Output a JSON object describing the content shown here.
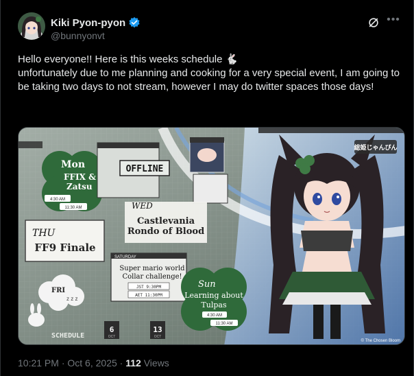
{
  "author": {
    "display_name": "Kiki Pyon-pyon",
    "handle": "@bunnyonvt"
  },
  "tweet": {
    "line1": "Hello everyone!! Here is this weeks schedule 🐇",
    "line2": "unfortunately due to me planning and cooking for a very special event, I am going to be taking two days to not stream, however I may do twitter spaces those days!"
  },
  "meta": {
    "time": "10:21 PM",
    "separator": "·",
    "date": "Oct 6, 2025",
    "views_count": "112",
    "views_label": "Views"
  },
  "schedule": {
    "mon_day": "Mon",
    "mon_title_1": "FFIX &",
    "mon_title_2": "Zatsu",
    "mon_time_1": "4:30 AM",
    "mon_time_2": "11:30 AM",
    "offline_label": "OFFLINE",
    "wed_day": "WED",
    "wed_title_1": "Castlevania",
    "wed_title_2": "Rondo of Blood",
    "thu_day": "THU",
    "thu_title": "FF9 Finale",
    "sat_label": "SATURDAY",
    "sat_title_1": "Super mario world",
    "sat_title_2": "Collar challenge!",
    "sat_time_1": "JST 9:30PM",
    "sat_time_2": "AET 11:30PM",
    "sun_day": "Sun",
    "sun_title_1": "Learning about",
    "sun_title_2": "Tulpas",
    "sun_time_1": "4:30 AM",
    "sun_time_2": "11:30 AM",
    "schedule_word": "SCHEDULE",
    "date_start": "6",
    "date_end": "13",
    "month_start": "OCT",
    "month_end": "OCT",
    "fri_label": "FRI",
    "sleep_z": "z z z",
    "logo_text": "総姫じゃんぴん",
    "credit": "© The Chosen Bloom"
  },
  "colors": {
    "accent_blue": "#1d9bf0",
    "muted": "#71767b",
    "text": "#e7e9ea",
    "border": "#2f3336",
    "clover_green": "#2f6a3a"
  }
}
